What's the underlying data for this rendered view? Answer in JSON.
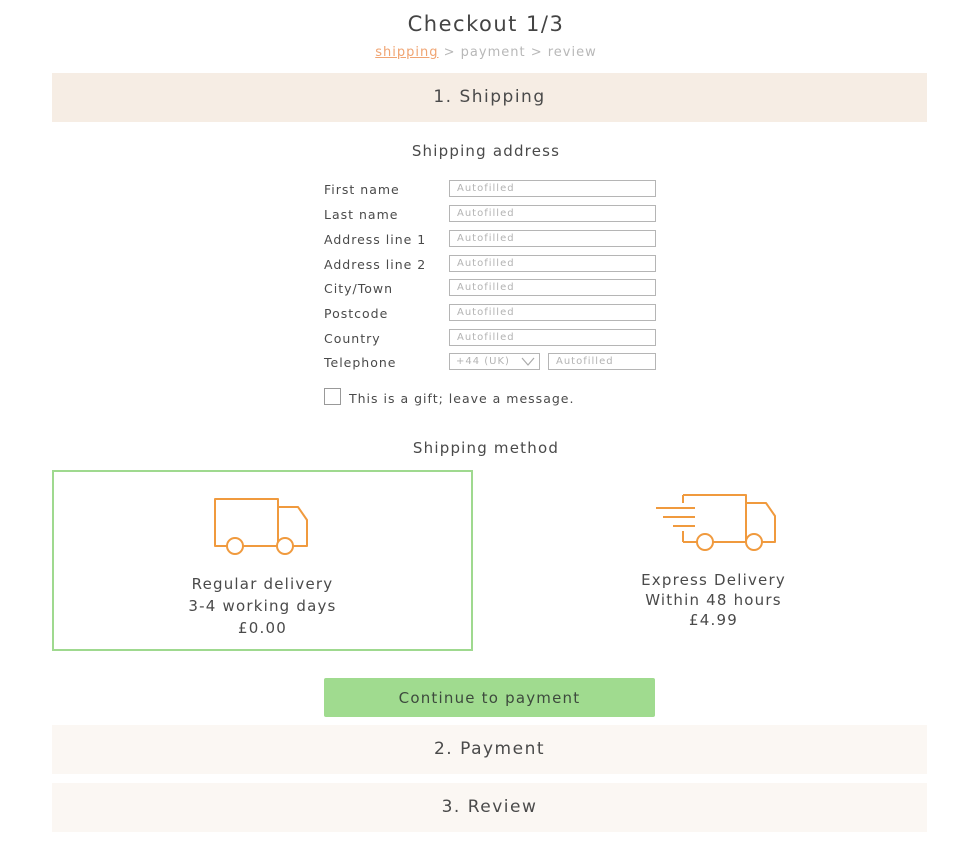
{
  "page": {
    "title": "Checkout 1/3"
  },
  "breadcrumb": {
    "step1": "shipping",
    "sep1": " > ",
    "step2": "payment",
    "sep2": " > ",
    "step3": "review"
  },
  "sections": {
    "shipping": "1. Shipping",
    "payment": "2. Payment",
    "review": "3. Review"
  },
  "address": {
    "heading": "Shipping address",
    "fields": [
      {
        "label": "First name",
        "placeholder": "Autofilled"
      },
      {
        "label": "Last name",
        "placeholder": "Autofilled"
      },
      {
        "label": "Address line 1",
        "placeholder": "Autofilled"
      },
      {
        "label": "Address line 2",
        "placeholder": "Autofilled"
      },
      {
        "label": "City/Town",
        "placeholder": "Autofilled"
      },
      {
        "label": "Postcode",
        "placeholder": "Autofilled"
      },
      {
        "label": "Country",
        "placeholder": "Autofilled"
      }
    ],
    "telephone": {
      "label": "Telephone",
      "country_code": "+44 (UK)",
      "placeholder": "Autofilled"
    },
    "gift_label": "This is a gift; leave a message."
  },
  "method": {
    "heading": "Shipping method",
    "regular": {
      "title": "Regular delivery",
      "time": "3-4 working days",
      "price": "£0.00",
      "selected": true,
      "icon": "truck-icon"
    },
    "express": {
      "title": "Express Delivery",
      "time": "Within 48 hours",
      "price": "£4.99",
      "icon": "fast-truck-icon"
    }
  },
  "actions": {
    "continue_label": "Continue to payment"
  },
  "colors": {
    "accent": "#f09a3e",
    "selected_border": "#9fd98f",
    "button": "#a0db8f",
    "active_bar": "#f6ede4",
    "inactive_bar": "#fbf7f3",
    "breadcrumb_active": "#f0a472"
  }
}
